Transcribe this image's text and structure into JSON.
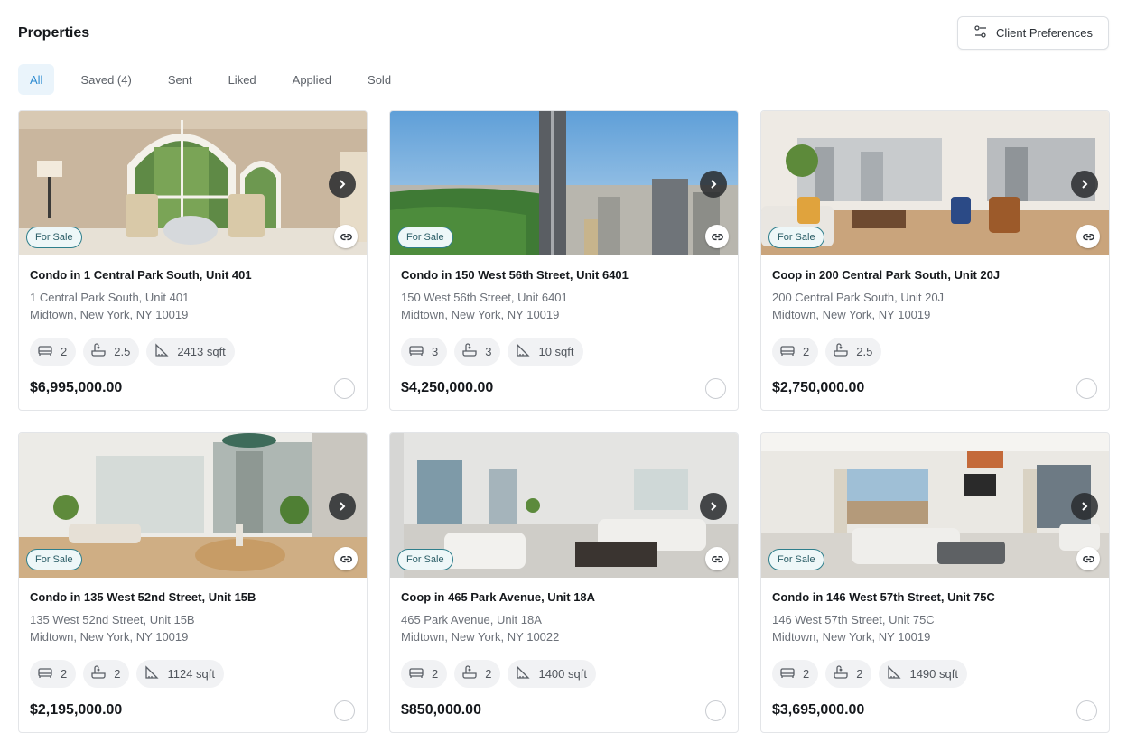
{
  "header": {
    "title": "Properties",
    "pref_button": "Client Preferences"
  },
  "tabs": [
    "All",
    "Saved (4)",
    "Sent",
    "Liked",
    "Applied",
    "Sold"
  ],
  "active_tab": "All",
  "cards": [
    {
      "badge": "For Sale",
      "title": "Condo in 1 Central Park South, Unit 401",
      "addr1": "1 Central Park South, Unit 401",
      "addr2": "Midtown, New York, NY 10019",
      "beds": "2",
      "baths": "2.5",
      "sqft": "2413 sqft",
      "price": "$6,995,000.00"
    },
    {
      "badge": "For Sale",
      "title": "Condo in 150 West 56th Street, Unit 6401",
      "addr1": "150 West 56th Street, Unit 6401",
      "addr2": "Midtown, New York, NY 10019",
      "beds": "3",
      "baths": "3",
      "sqft": "10 sqft",
      "price": "$4,250,000.00"
    },
    {
      "badge": "For Sale",
      "title": "Coop in 200 Central Park South, Unit 20J",
      "addr1": "200 Central Park South, Unit 20J",
      "addr2": "Midtown, New York, NY 10019",
      "beds": "2",
      "baths": "2.5",
      "price": "$2,750,000.00"
    },
    {
      "badge": "For Sale",
      "title": "Condo in 135 West 52nd Street, Unit 15B",
      "addr1": "135 West 52nd Street, Unit 15B",
      "addr2": "Midtown, New York, NY 10019",
      "beds": "2",
      "baths": "2",
      "sqft": "1124 sqft",
      "price": "$2,195,000.00"
    },
    {
      "badge": "For Sale",
      "title": "Coop in 465 Park Avenue, Unit 18A",
      "addr1": "465 Park Avenue, Unit 18A",
      "addr2": "Midtown, New York, NY 10022",
      "beds": "2",
      "baths": "2",
      "sqft": "1400 sqft",
      "price": "$850,000.00"
    },
    {
      "badge": "For Sale",
      "title": "Condo in 146 West 57th Street, Unit 75C",
      "addr1": "146 West 57th Street, Unit 75C",
      "addr2": "Midtown, New York, NY 10019",
      "beds": "2",
      "baths": "2",
      "sqft": "1490 sqft",
      "price": "$3,695,000.00"
    }
  ],
  "colors": {
    "accent": "#2d8bd1",
    "badge_border": "#2f7f8c",
    "tab_active_bg": "#eaf4fb"
  }
}
